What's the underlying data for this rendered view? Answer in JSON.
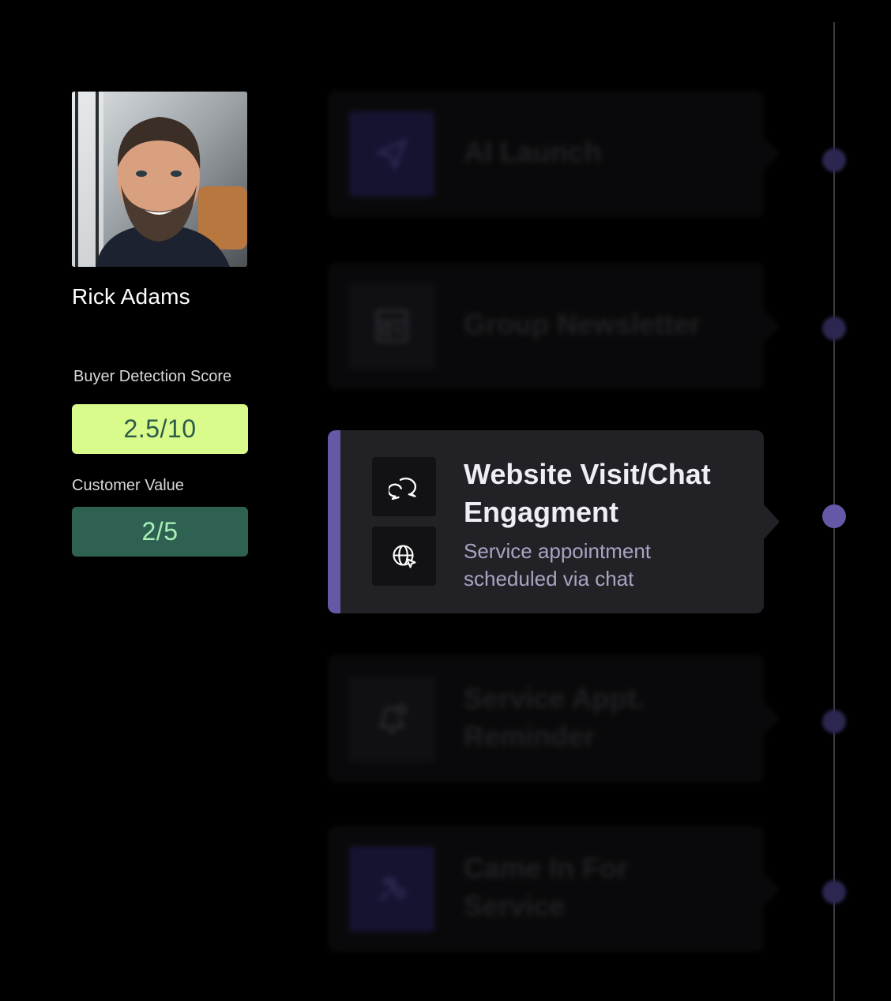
{
  "profile": {
    "name": "Rick Adams",
    "buyer_detection_label": "Buyer Detection Score",
    "buyer_detection_score": "2.5/10",
    "customer_value_label": "Customer Value",
    "customer_value": "2/5"
  },
  "timeline": {
    "events": [
      {
        "title": "AI Launch",
        "icon": "send-icon",
        "state": "blurred"
      },
      {
        "title": "Group Newsletter",
        "icon": "newsletter-icon",
        "state": "blurred"
      },
      {
        "title": "Website Visit/Chat Engagment",
        "subtitle": "Service appointment scheduled via chat",
        "icons": [
          "chat-bubbles-icon",
          "globe-cursor-icon"
        ],
        "state": "active"
      },
      {
        "title": "Service Appt. Reminder",
        "icon": "bell-icon",
        "state": "blurred"
      },
      {
        "title": "Came In For Service",
        "icon": "wrench-icon",
        "state": "blurred"
      }
    ]
  },
  "colors": {
    "accent": "#6558a6",
    "buyer_badge_bg": "#d9fb8b",
    "customer_value_bg": "#2f6152"
  }
}
